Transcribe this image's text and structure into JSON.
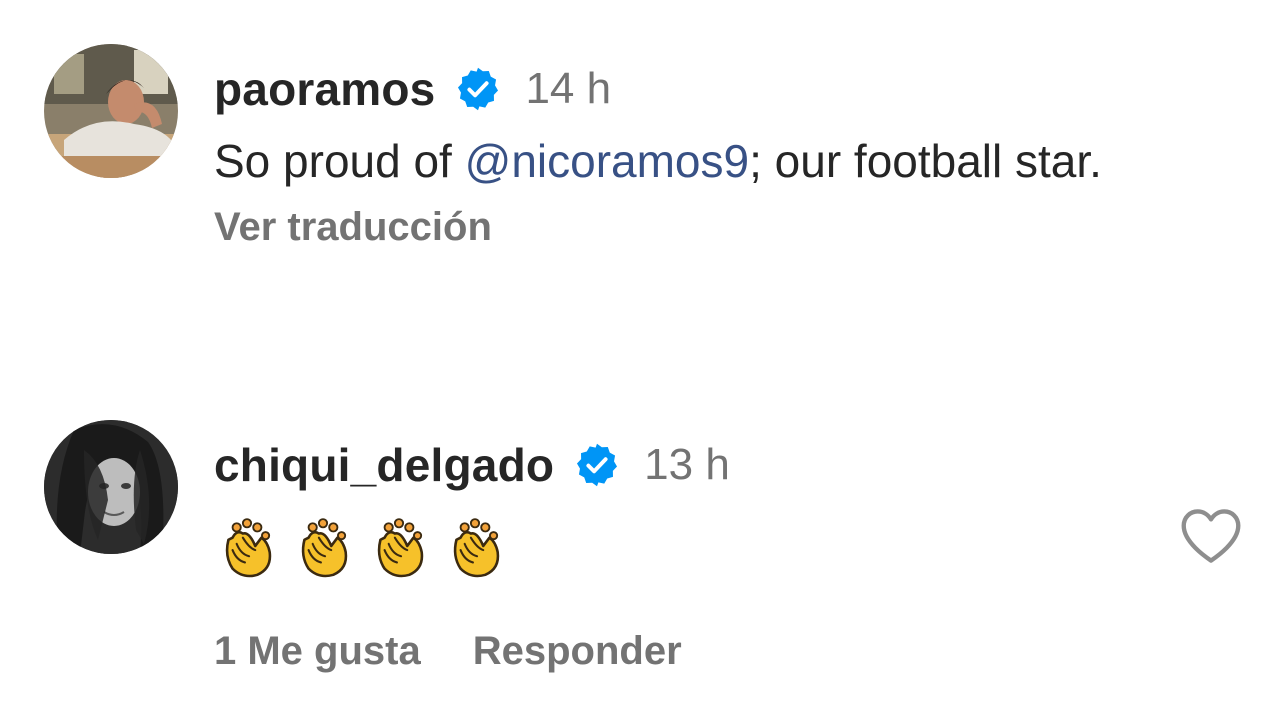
{
  "comments": [
    {
      "username": "paoramos",
      "verified": true,
      "timestamp": "14 h",
      "text_before_mention": "So proud of ",
      "mention": "@nicoramos9",
      "text_after_mention": "; our football star.",
      "see_translation": "Ver traducción"
    },
    {
      "username": "chiqui_delgado",
      "verified": true,
      "timestamp": "13 h",
      "emojis": [
        "👏",
        "👏",
        "👏",
        "👏"
      ],
      "likes_label": "1 Me gusta",
      "reply_label": "Responder"
    }
  ],
  "icons": {
    "verified": "verified-badge-icon",
    "like": "heart-icon",
    "emoji": "clapping-hands"
  },
  "colors": {
    "verified_blue": "#0095f6",
    "mention_blue": "#385185",
    "secondary_text": "#737373",
    "primary_text": "#262626"
  }
}
